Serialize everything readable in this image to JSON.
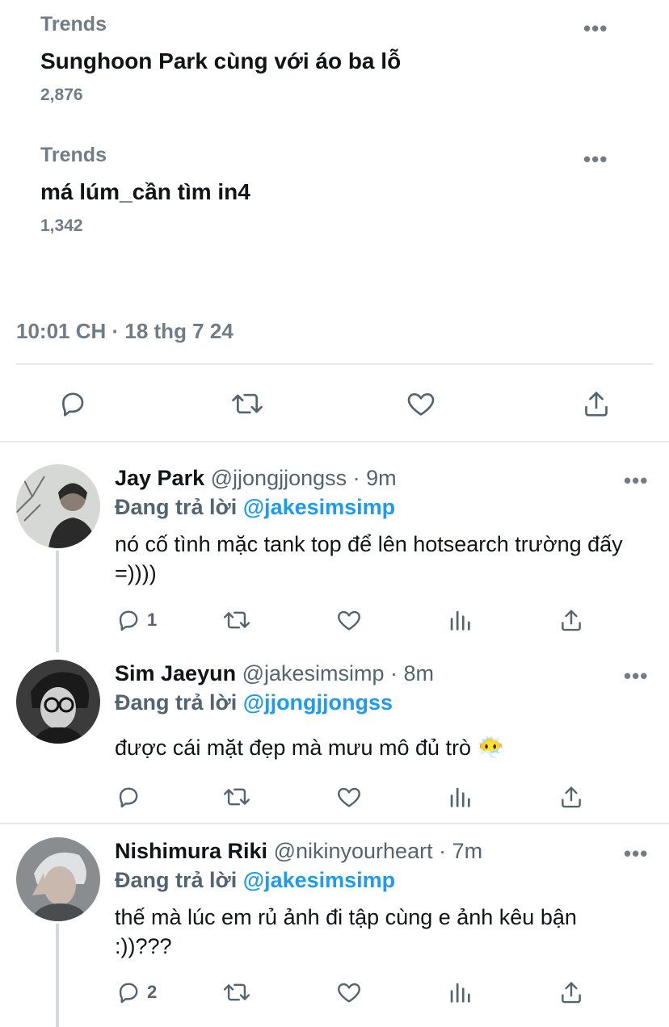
{
  "trends": [
    {
      "kind": "Trends",
      "title": "Sunghoon Park cùng với áo ba lỗ",
      "count": "2,876",
      "more": "•••"
    },
    {
      "kind": "Trends",
      "title": "má lúm_cần tìm in4",
      "count": "1,342",
      "more": "•••"
    }
  ],
  "tweet": {
    "timestamp": "10:01 CH · 18 thg 7 24",
    "actions": {
      "reply": "reply-icon",
      "retweet": "retweet-icon",
      "like": "heart-icon",
      "share": "share-icon"
    }
  },
  "replies": [
    {
      "name": "Jay Park",
      "handle": "@jjongjjongss",
      "time": "· 9m",
      "replying_label": "Đang trả lời",
      "replying_to": "@jakesimsimp",
      "text": "nó cố tình mặc tank top để lên hotsearch trường đấy =))))",
      "reply_count": "1",
      "more": "•••",
      "avatar_colors": [
        "#d6d8d6",
        "#6b6f6e",
        "#2a2a2a"
      ]
    },
    {
      "name": "Sim Jaeyun",
      "handle": "@jakesimsimp",
      "time": "· 8m",
      "replying_label": "Đang trả lời",
      "replying_to": "@jjongjjongss",
      "text": "được cái mặt đẹp mà mưu mô đủ trò",
      "emoji": "😶‍🌫️",
      "reply_count": "",
      "more": "•••",
      "avatar_colors": [
        "#3b3b3b",
        "#1a1a1a",
        "#cfcfcf"
      ]
    },
    {
      "name": "Nishimura Riki",
      "handle": "@nikinyourheart",
      "time": "· 7m",
      "replying_label": "Đang trả lời",
      "replying_to": "@jakesimsimp",
      "text": "thế mà lúc em rủ ảnh đi tập cùng e ảnh kêu bận :))???",
      "reply_count": "2",
      "more": "•••",
      "avatar_colors": [
        "#8a8d8f",
        "#dfe1e2",
        "#4a4d4f"
      ]
    }
  ],
  "colors": {
    "accent": "#1d9bf0",
    "muted": "#536471",
    "divider": "#e7e9eb"
  }
}
